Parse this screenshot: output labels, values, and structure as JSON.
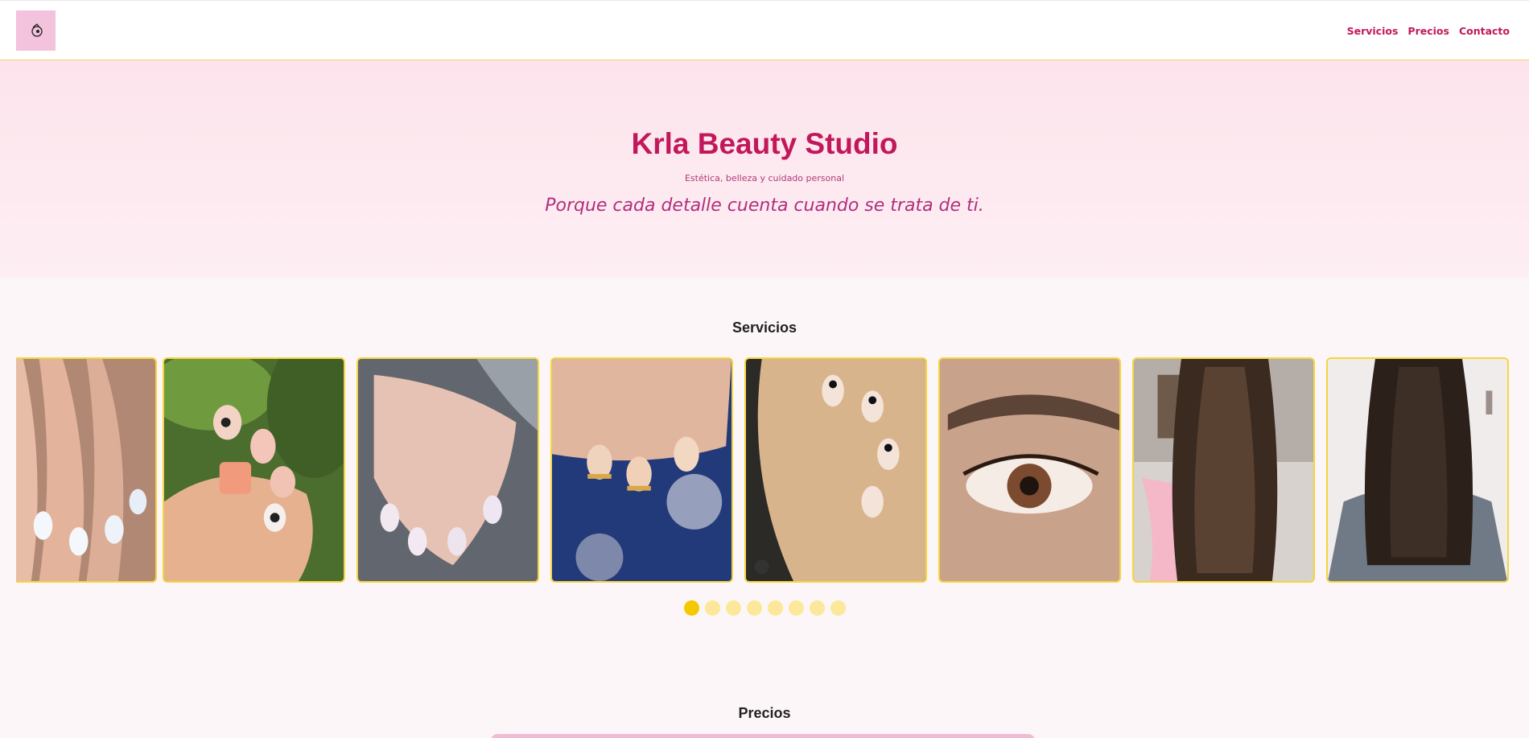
{
  "header": {
    "logo_text": "Krla Beauty Studio",
    "nav": [
      "Servicios",
      "Precios",
      "Contacto"
    ]
  },
  "hero": {
    "title": "Krla Beauty Studio",
    "subtitle": "Estética, belleza y cuidado personal",
    "slogan": "Porque cada detalle cuenta cuando se trata de ti."
  },
  "services": {
    "title": "Servicios",
    "gallery_icons": [
      "white-nails-photo-icon",
      "cartoon-nail-art-photo-icon",
      "pink-glitter-nails-photo-icon",
      "gold-glitter-nails-photo-icon",
      "french-heart-nails-photo-icon",
      "eyelash-photo-icon",
      "long-straight-hair-photo-icon",
      "straight-hair-back-photo-icon"
    ],
    "dots_count": 8,
    "active_dot": 0
  },
  "prices": {
    "title": "Precios"
  },
  "colors": {
    "accent": "#c2185b",
    "border": "#f5d53d",
    "hero_bg": "#fde4ec",
    "dot_active": "#f5c800",
    "dot_inactive": "#fbe89a"
  }
}
